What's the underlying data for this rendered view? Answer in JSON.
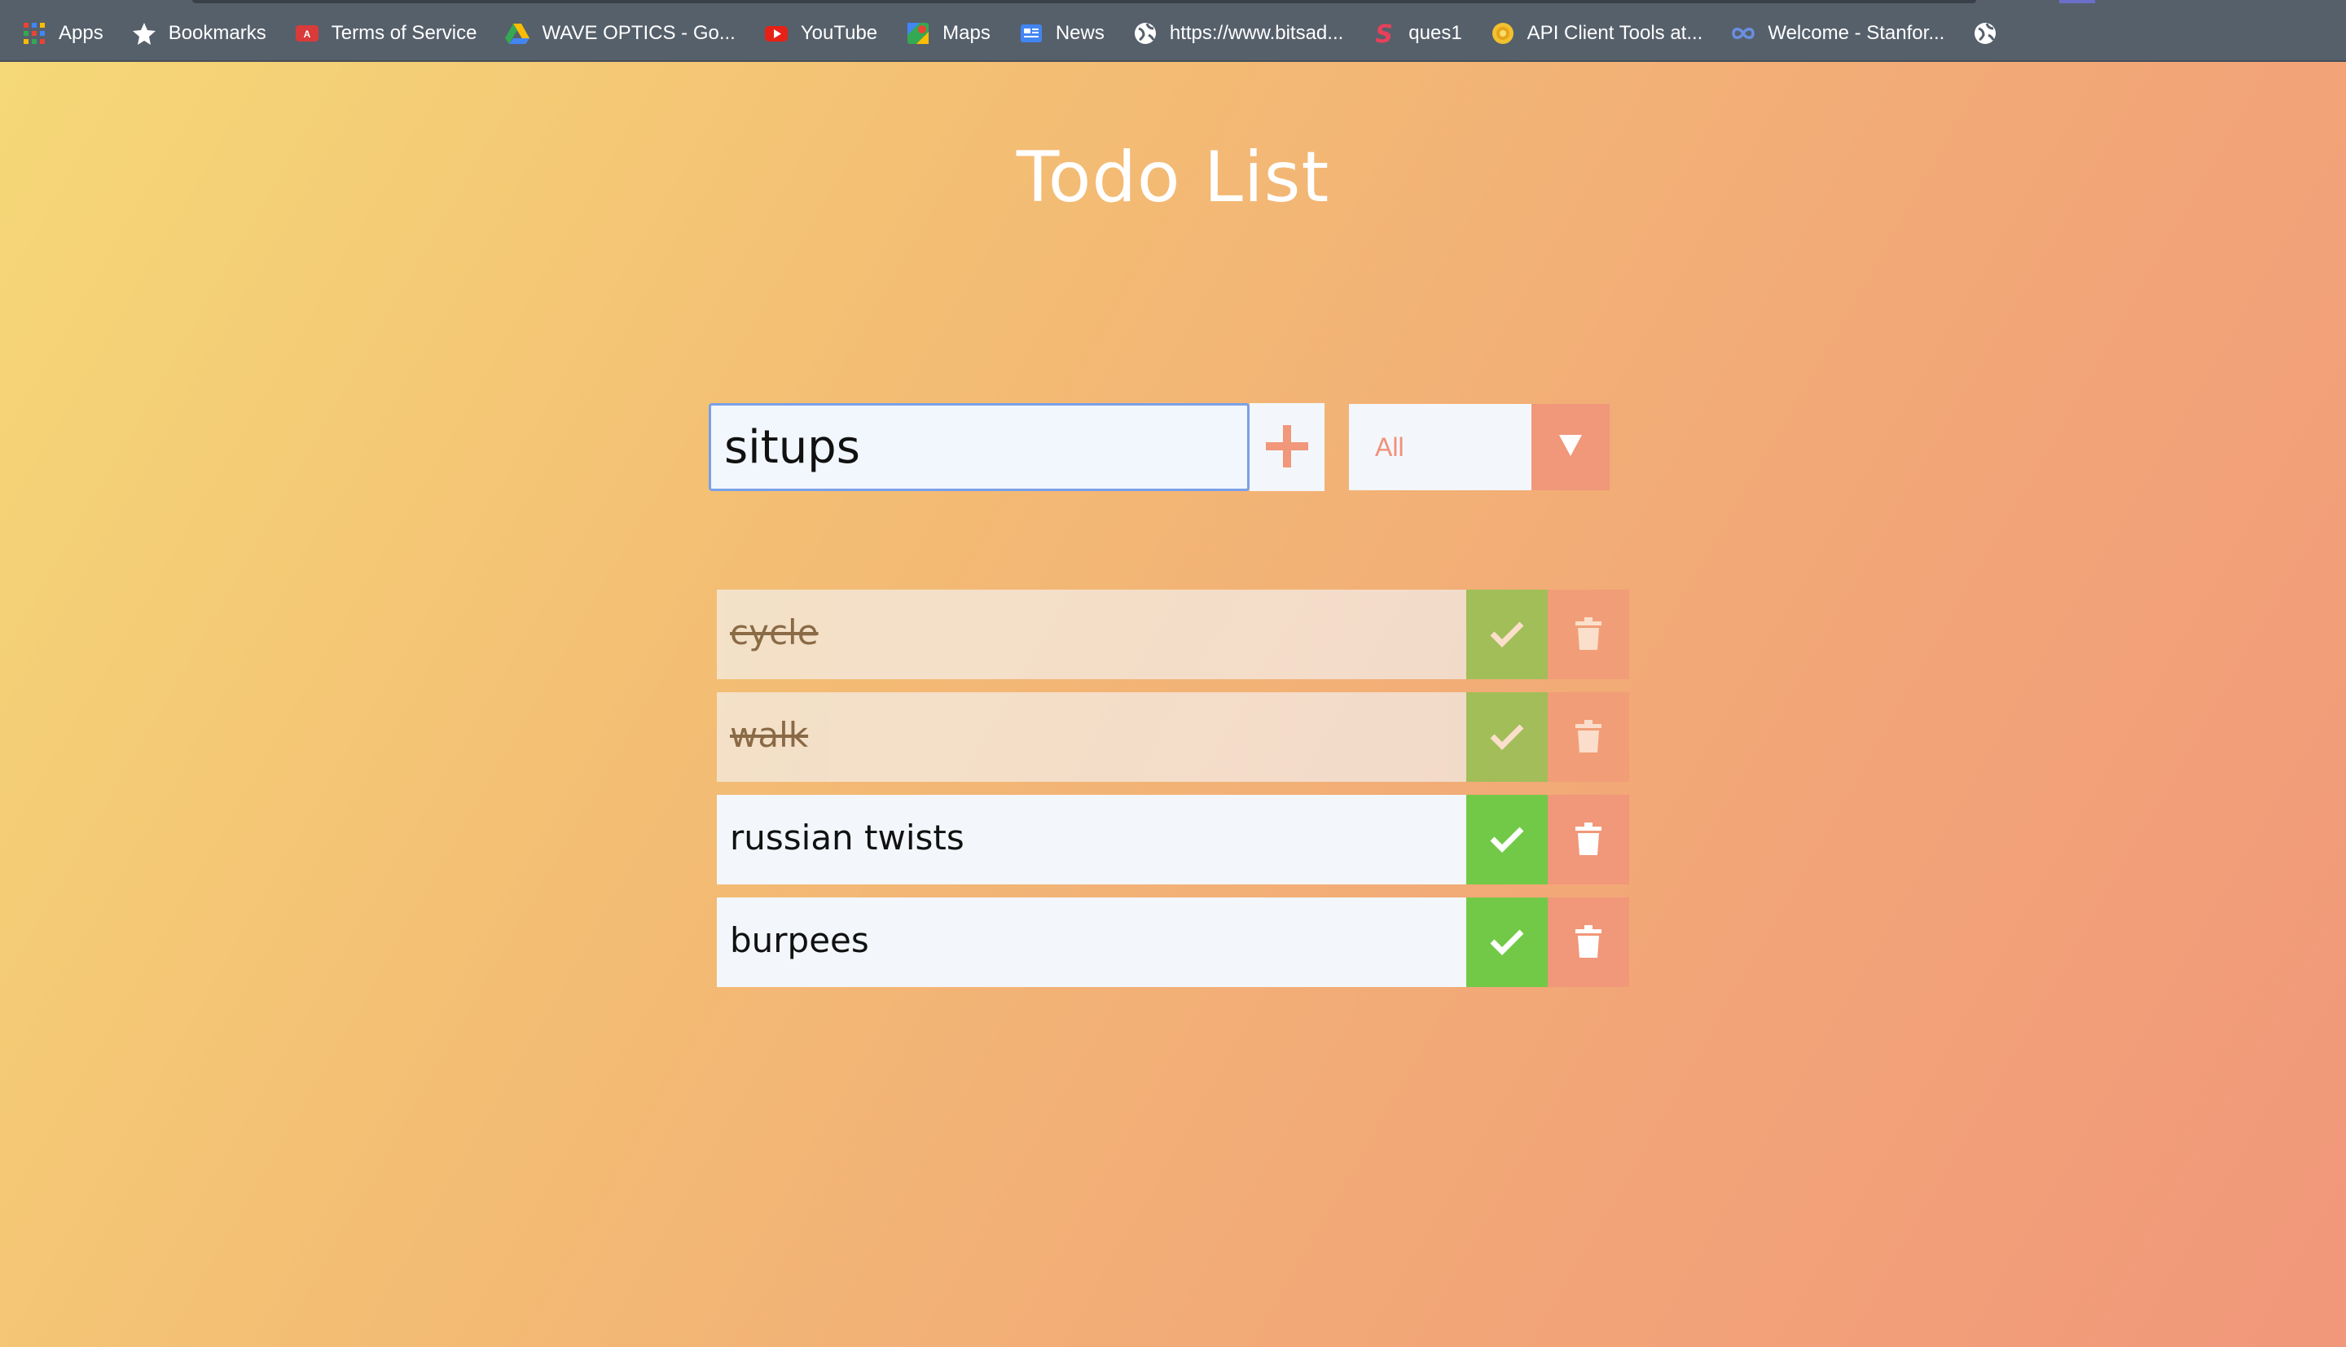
{
  "bookmarks": [
    {
      "label": "Apps",
      "icon": "apps-grid-icon"
    },
    {
      "label": "Bookmarks",
      "icon": "star-icon"
    },
    {
      "label": "Terms of Service",
      "icon": "acrobat-icon"
    },
    {
      "label": "WAVE OPTICS - Go...",
      "icon": "google-drive-icon"
    },
    {
      "label": "YouTube",
      "icon": "youtube-icon"
    },
    {
      "label": "Maps",
      "icon": "maps-icon"
    },
    {
      "label": "News",
      "icon": "google-news-icon"
    },
    {
      "label": "https://www.bitsad...",
      "icon": "globe-icon"
    },
    {
      "label": "ques1",
      "icon": "s-logo-icon"
    },
    {
      "label": "API Client Tools at...",
      "icon": "gear-sun-icon"
    },
    {
      "label": "Welcome - Stanfor...",
      "icon": "infinity-icon"
    },
    {
      "label": "",
      "icon": "globe-icon"
    }
  ],
  "app": {
    "title": "Todo List",
    "input_value": "situps",
    "filter_selected": "All"
  },
  "todos": [
    {
      "text": "cycle",
      "completed": true
    },
    {
      "text": "walk",
      "completed": true
    },
    {
      "text": "russian twists",
      "completed": false
    },
    {
      "text": "burpees",
      "completed": false
    }
  ],
  "colors": {
    "accent": "#f1977a",
    "check": "#72c947",
    "input_focus": "#7aa0e8",
    "gradient_start": "#f5d877",
    "gradient_end": "#f1977a"
  }
}
